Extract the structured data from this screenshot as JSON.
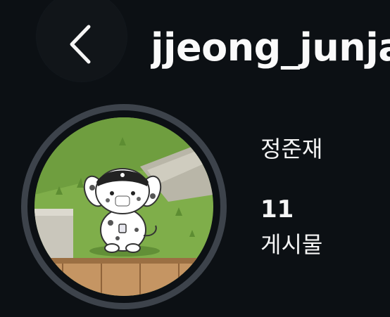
{
  "header": {
    "back_icon": "chevron-left-icon",
    "username": "jjeong_junjae"
  },
  "profile": {
    "avatar_description_icon": "dog-avatar",
    "display_name": "정준재",
    "stats": {
      "posts_count": "11",
      "posts_label": "게시물"
    }
  },
  "colors": {
    "background": "#0c1014",
    "text": "#f5f5f5",
    "avatar_ring": "#3d434b"
  }
}
